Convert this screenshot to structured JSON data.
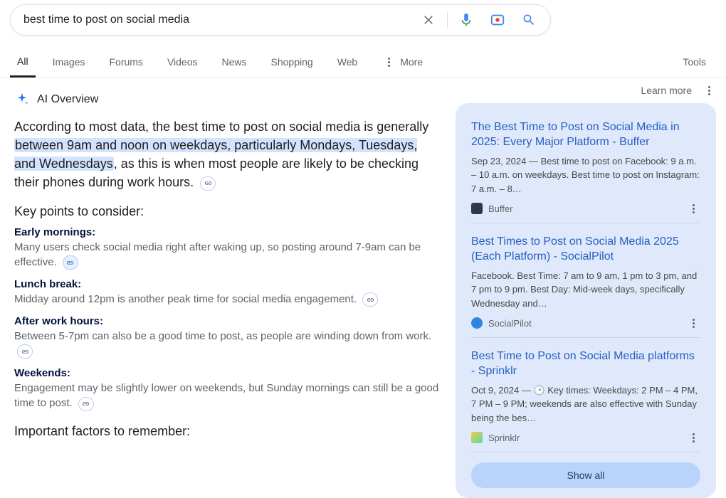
{
  "search": {
    "query": "best time to post on social media"
  },
  "tabs": {
    "all": "All",
    "images": "Images",
    "forums": "Forums",
    "videos": "Videos",
    "news": "News",
    "shopping": "Shopping",
    "web": "Web",
    "more": "More",
    "tools": "Tools"
  },
  "ai": {
    "label": "AI Overview",
    "learn_more": "Learn more",
    "overview_pre": "According to most data, the best time to post on social media is generally ",
    "overview_hl": "between 9am and noon on weekdays, particularly Mondays, Tuesdays, and Wednesdays",
    "overview_post": ", as this is when most people are likely to be checking their phones during work hours. ",
    "section1_head": "Key points to consider:",
    "points": [
      {
        "title": "Early mornings:",
        "body": "Many users check social media right after waking up, so posting around 7-9am can be effective. "
      },
      {
        "title": "Lunch break:",
        "body": "Midday around 12pm is another peak time for social media engagement. "
      },
      {
        "title": "After work hours:",
        "body": "Between 5-7pm can also be a good time to post, as people are winding down from work. "
      },
      {
        "title": "Weekends:",
        "body": "Engagement may be slightly lower on weekends, but Sunday mornings can still be a good time to post. "
      }
    ],
    "section2_head": "Important factors to remember:"
  },
  "refs": [
    {
      "title": "The Best Time to Post on Social Media in 2025: Every Major Platform - Buffer",
      "snippet_pre": "Sep 23, 2024 — ",
      "snippet": "Best time to post on Facebook: 9 a.m. – 10 a.m. on weekdays. Best time to post on Instagram: 7 a.m. – 8…",
      "source": "Buffer",
      "favicon": "#2b3a4a"
    },
    {
      "title": "Best Times to Post on Social Media 2025 (Each Platform) - SocialPilot",
      "snippet_pre": "",
      "snippet": "Facebook. Best Time: 7 am to 9 am, 1 pm to 3 pm, and 7 pm to 9 pm. Best Day: Mid-week days, specifically Wednesday and…",
      "source": "SocialPilot",
      "favicon": "#2e86de"
    },
    {
      "title": "Best Time to Post on Social Media platforms - Sprinklr",
      "snippet_pre": "Oct 9, 2024 — ",
      "snippet": "🕑 Key times: Weekdays: 2 PM – 4 PM, 7 PM – 9 PM; weekends are also effective with Sunday being the bes…",
      "source": "Sprinklr",
      "favicon": "#54d9a8"
    }
  ],
  "show_all": "Show all"
}
